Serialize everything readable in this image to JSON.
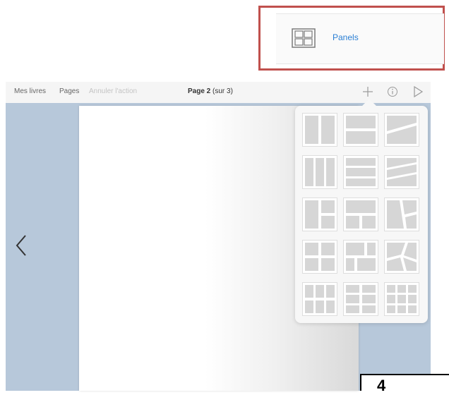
{
  "callout": {
    "label": "Panels",
    "icon": "panels-icon",
    "border_color": "#c0504d"
  },
  "toolbar": {
    "my_books": "Mes livres",
    "pages": "Pages",
    "undo": "Annuler l'action",
    "page_title_bold": "Page 2",
    "page_title_rest": " (sur 3)",
    "icons": [
      "plus-icon",
      "info-icon",
      "play-icon"
    ]
  },
  "canvas": {
    "background": "#b7c8da",
    "back_icon": "chevron-left-icon"
  },
  "popover": {
    "layouts": [
      "layout-2-columns",
      "layout-2-rows",
      "layout-2-diagonal",
      "layout-3-columns",
      "layout-3-rows",
      "layout-3-diagonal",
      "layout-L-left",
      "layout-T-top",
      "layout-diagonal-mixed",
      "layout-2x2",
      "layout-brick",
      "layout-diagonal-cross",
      "layout-3x3-a",
      "layout-3x3-b",
      "layout-3x3-c"
    ]
  },
  "corner": {
    "text": "4"
  }
}
